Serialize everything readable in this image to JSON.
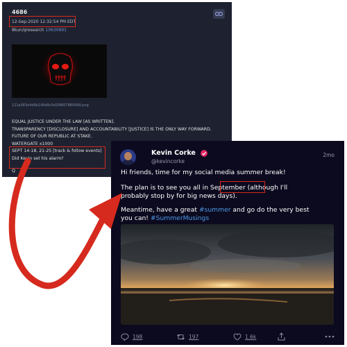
{
  "qpost": {
    "post_number": "4686",
    "date": "12-Sep-2020 12:32:54 PM EDT",
    "board": "8kun/qresearch",
    "board_link": "10630891",
    "filename": "121a083e4d6b149d9c5d2f9807880499.png",
    "lines": [
      "EQUAL JUSTICE UNDER THE LAW [AS WRITTEN].",
      "TRANSPARENCY [DISCLOSURE] AND ACCOUNTABILITY [JUSTICE] IS THE ONLY WAY FORWARD.",
      "FUTURE OF OUR REPUBLIC AT STAKE.",
      "WATERGATE x1000",
      "SEPT 14-18, 21-25 [track & follow events]",
      "Did Kevin set his alarm?"
    ],
    "signoff": "Q"
  },
  "tweet": {
    "name": "Kevin Corke",
    "handle": "@kevincorke",
    "time": "2mo",
    "line1": "Hi friends, time for my social media summer break!",
    "line2a": "The plan is to see you all in September (although I'll",
    "line2b": "probably stop by for big news days).",
    "line3a_prefix": "Meantime, have a great ",
    "hashtag1": "#summer",
    "line3a_suffix": " and go do the very best",
    "line3b_prefix": "you can! ",
    "hashtag2": "#SummerMusings",
    "counts": {
      "replies": "198",
      "retweets": "197",
      "likes": "1.6k"
    }
  },
  "colors": {
    "accent": "#d62a1e",
    "hashtag": "#4c9be8",
    "panel": "#1e2230",
    "tweet_bg": "#0c0a1f"
  },
  "icons": [
    "link-icon",
    "verified-icon",
    "reply-icon",
    "retweet-icon",
    "like-icon",
    "share-icon",
    "more-icon"
  ]
}
